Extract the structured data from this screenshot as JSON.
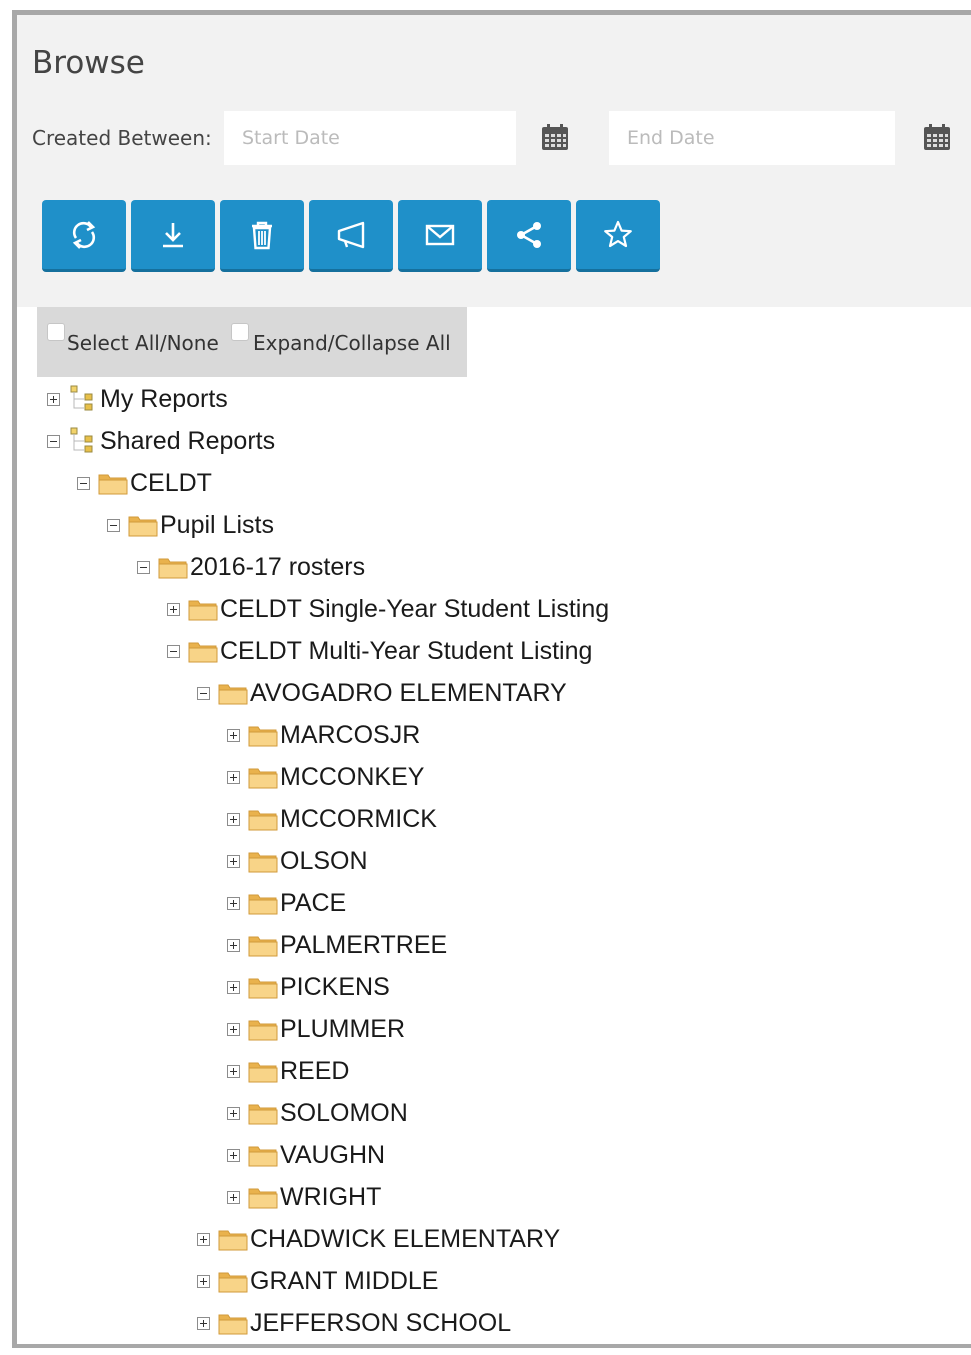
{
  "header": {
    "title": "Browse",
    "created_between_label": "Created Between:",
    "start_date_placeholder": "Start Date",
    "start_date_value": "",
    "end_date_placeholder": "End Date",
    "end_date_value": ""
  },
  "toolbar": {
    "buttons": [
      {
        "icon": "refresh-icon"
      },
      {
        "icon": "download-icon"
      },
      {
        "icon": "trash-icon"
      },
      {
        "icon": "megaphone-icon"
      },
      {
        "icon": "envelope-icon"
      },
      {
        "icon": "share-icon"
      },
      {
        "icon": "star-icon"
      }
    ]
  },
  "selection": {
    "select_all_label": "Select All/None",
    "expand_collapse_label": "Expand/Collapse All"
  },
  "colors": {
    "button_blue": "#1f90c9",
    "folder_yellow": "#f5c86a"
  },
  "tree": {
    "my_reports": "My Reports",
    "shared_reports": "Shared Reports",
    "celdt": "CELDT",
    "pupil_lists": "Pupil Lists",
    "rosters": "2016-17 rosters",
    "single_year": "CELDT Single-Year Student Listing",
    "multi_year": "CELDT Multi-Year Student Listing",
    "avogadro": "AVOGADRO ELEMENTARY",
    "teachers": [
      "MARCOSJR",
      "MCCONKEY",
      "MCCORMICK",
      "OLSON",
      "PACE",
      "PALMERTREE",
      "PICKENS",
      "PLUMMER",
      "REED",
      "SOLOMON",
      "VAUGHN",
      "WRIGHT"
    ],
    "chadwick": "CHADWICK ELEMENTARY",
    "grant": "GRANT MIDDLE",
    "jefferson": "JEFFERSON SCHOOL"
  }
}
